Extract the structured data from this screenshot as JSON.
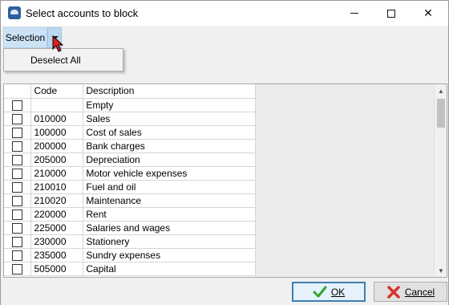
{
  "window": {
    "title": "Select accounts to block",
    "icon": "app-icon",
    "controls": {
      "minimize": "minimize-icon",
      "maximize": "maximize-icon",
      "close": "close-icon",
      "close_glyph": "✕"
    }
  },
  "toolbar": {
    "selection_label": "Selection",
    "dropdown_icon": "chevron-down-icon"
  },
  "menu": {
    "items": [
      {
        "label": "Deselect All"
      }
    ]
  },
  "grid": {
    "columns": {
      "check": "",
      "code": "Code",
      "description": "Description"
    },
    "rows": [
      {
        "code": "",
        "description": "Empty",
        "checked": false
      },
      {
        "code": "010000",
        "description": "Sales",
        "checked": false
      },
      {
        "code": "100000",
        "description": "Cost of sales",
        "checked": false
      },
      {
        "code": "200000",
        "description": "Bank charges",
        "checked": false
      },
      {
        "code": "205000",
        "description": "Depreciation",
        "checked": false
      },
      {
        "code": "210000",
        "description": "Motor vehicle expenses",
        "checked": false
      },
      {
        "code": "210010",
        "description": "Fuel and oil",
        "checked": false
      },
      {
        "code": "210020",
        "description": "Maintenance",
        "checked": false
      },
      {
        "code": "220000",
        "description": "Rent",
        "checked": false
      },
      {
        "code": "225000",
        "description": "Salaries and wages",
        "checked": false
      },
      {
        "code": "230000",
        "description": "Stationery",
        "checked": false
      },
      {
        "code": "235000",
        "description": "Sundry expenses",
        "checked": false
      },
      {
        "code": "505000",
        "description": "Capital",
        "checked": false
      }
    ]
  },
  "footer": {
    "ok": {
      "label": "OK",
      "icon": "checkmark-icon",
      "color": "#2fa82f"
    },
    "cancel": {
      "label": "Cancel",
      "icon": "x-cross-icon",
      "color": "#d9322b"
    }
  },
  "colors": {
    "accent": "#cde2f5",
    "cursor": "#e02020"
  }
}
